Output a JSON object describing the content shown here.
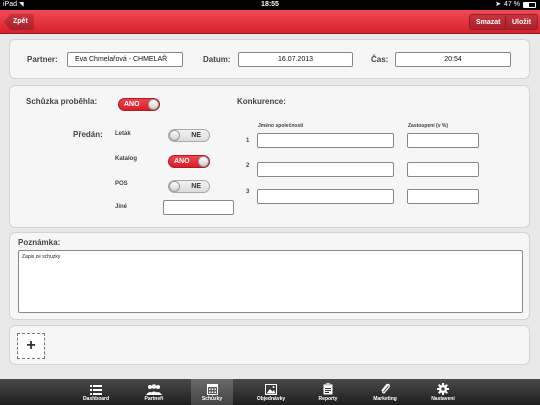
{
  "status_bar": {
    "carrier": "iPad",
    "time": "18:55",
    "battery": "47 %",
    "battery_level": 0.47
  },
  "nav": {
    "back_label": "Zpět",
    "delete_label": "Smazat",
    "save_label": "Uložit"
  },
  "header_panel": {
    "partner_label": "Partner:",
    "partner_value": "Eva Chmelařová - CHMELAŘ",
    "date_label": "Datum:",
    "date_value": "16.07.2013",
    "time_label": "Čas:",
    "time_value": "20:54"
  },
  "meeting": {
    "happened_label": "Schůzka proběhla:",
    "happened_value": "ANO",
    "handed_label": "Předán:",
    "items": [
      {
        "label": "Leták",
        "value": "NE"
      },
      {
        "label": "Katalog",
        "value": "ANO"
      },
      {
        "label": "POS",
        "value": "NE"
      }
    ],
    "other_label": "Jiné",
    "other_value": ""
  },
  "competition": {
    "title": "Konkurence:",
    "col_name": "Jméno společnosti",
    "col_share": "Zastoupení (v %)",
    "rows": [
      {
        "num": "1",
        "name": "",
        "share": ""
      },
      {
        "num": "2",
        "name": "",
        "share": ""
      },
      {
        "num": "3",
        "name": "",
        "share": ""
      }
    ]
  },
  "note": {
    "label": "Poznámka:",
    "value": "Zapis ze schuzky"
  },
  "add_button_label": "+",
  "tabs": [
    {
      "label": "Dashboard",
      "icon": "list-icon"
    },
    {
      "label": "Partneři",
      "icon": "people-icon"
    },
    {
      "label": "Schůzky",
      "icon": "calendar-icon"
    },
    {
      "label": "Objednávky",
      "icon": "image-icon"
    },
    {
      "label": "Reporty",
      "icon": "clipboard-icon"
    },
    {
      "label": "Marketing",
      "icon": "paperclip-icon"
    },
    {
      "label": "Nastavení",
      "icon": "gear-icon"
    }
  ],
  "colors": {
    "accent": "#e1313c",
    "tabbar": "#2a2a2a"
  }
}
